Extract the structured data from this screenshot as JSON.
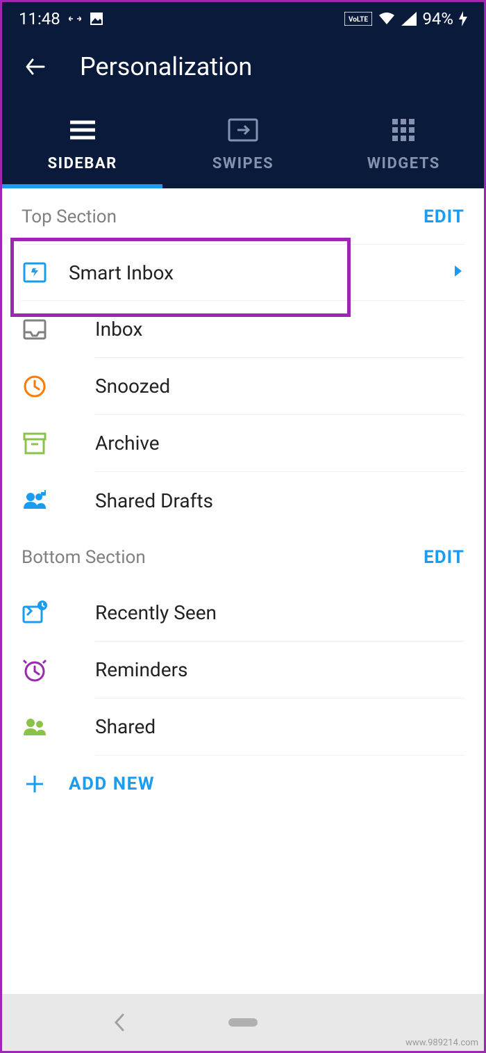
{
  "status": {
    "time": "11:48",
    "volte": "VoLTE",
    "battery_pct": "94%"
  },
  "header": {
    "title": "Personalization"
  },
  "tabs": [
    {
      "label": "SIDEBAR"
    },
    {
      "label": "SWIPES"
    },
    {
      "label": "WIDGETS"
    }
  ],
  "top_section": {
    "title": "Top Section",
    "edit": "EDIT",
    "items": [
      {
        "label": "Smart Inbox"
      },
      {
        "label": "Inbox"
      },
      {
        "label": "Snoozed"
      },
      {
        "label": "Archive"
      },
      {
        "label": "Shared Drafts"
      }
    ]
  },
  "bottom_section": {
    "title": "Bottom Section",
    "edit": "EDIT",
    "items": [
      {
        "label": "Recently Seen"
      },
      {
        "label": "Reminders"
      },
      {
        "label": "Shared"
      }
    ],
    "add_new": "ADD NEW"
  },
  "watermark": "www.989214.com"
}
